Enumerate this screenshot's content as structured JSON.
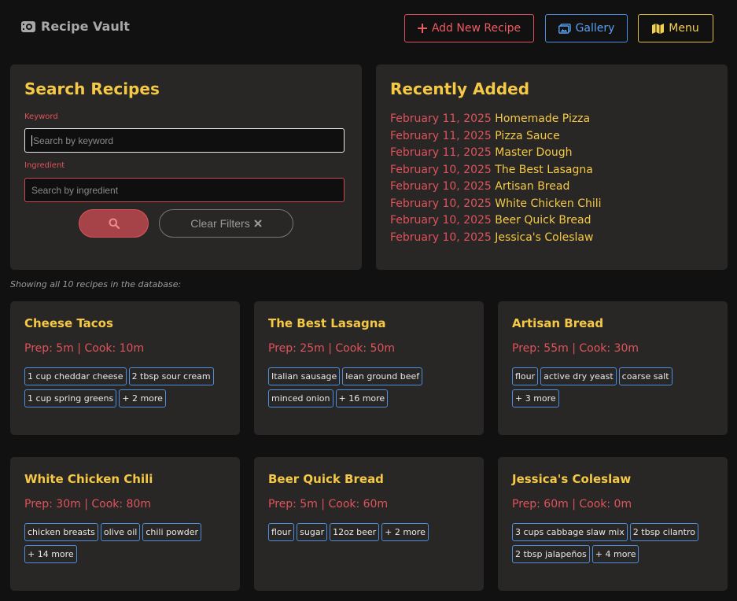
{
  "header": {
    "brand": "Recipe Vault",
    "add_label": "Add New Recipe",
    "gallery_label": "Gallery",
    "menu_label": "Menu"
  },
  "search": {
    "title": "Search Recipes",
    "keyword_label": "Keyword",
    "keyword_placeholder": "Search by keyword",
    "ingredient_label": "Ingredient",
    "ingredient_placeholder": "Search by ingredient",
    "clear_label": "Clear Filters"
  },
  "recent": {
    "title": "Recently Added",
    "items": [
      {
        "date": "February 11, 2025",
        "name": "Homemade Pizza"
      },
      {
        "date": "February 11, 2025",
        "name": "Pizza Sauce"
      },
      {
        "date": "February 11, 2025",
        "name": "Master Dough"
      },
      {
        "date": "February 10, 2025",
        "name": "The Best Lasagna"
      },
      {
        "date": "February 10, 2025",
        "name": "Artisan Bread"
      },
      {
        "date": "February 10, 2025",
        "name": "White Chicken Chili"
      },
      {
        "date": "February 10, 2025",
        "name": "Beer Quick Bread"
      },
      {
        "date": "February 10, 2025",
        "name": "Jessica's Coleslaw"
      }
    ]
  },
  "showing_text": "Showing all 10 recipes in the database:",
  "recipes": [
    {
      "title": "Cheese Tacos",
      "time": "Prep: 5m | Cook: 10m",
      "tags": [
        "1 cup cheddar cheese",
        "2 tbsp sour cream",
        "1 cup spring greens",
        "+ 2 more"
      ]
    },
    {
      "title": "The Best Lasagna",
      "time": "Prep: 25m | Cook: 50m",
      "tags": [
        "Italian sausage",
        "lean ground beef",
        "minced onion",
        "+ 16 more"
      ]
    },
    {
      "title": "Artisan Bread",
      "time": "Prep: 55m | Cook: 30m",
      "tags": [
        "flour",
        "active dry yeast",
        "coarse salt",
        "+ 3 more"
      ]
    },
    {
      "title": "White Chicken Chili",
      "time": "Prep: 30m | Cook: 80m",
      "tags": [
        "chicken breasts",
        "olive oil",
        "chili powder",
        "+ 14 more"
      ]
    },
    {
      "title": "Beer Quick Bread",
      "time": "Prep: 5m | Cook: 60m",
      "tags": [
        "flour",
        "sugar",
        "12oz beer",
        "+ 2 more"
      ]
    },
    {
      "title": "Jessica's Coleslaw",
      "time": "Prep: 60m | Cook: 0m",
      "tags": [
        "3 cups cabbage slaw mix",
        "2 tbsp cilantro",
        "2 tbsp jalapeños",
        "+ 4 more"
      ]
    }
  ],
  "colors": {
    "background": "#111111",
    "panel": "#282725",
    "accent_yellow": "#f5c946",
    "accent_red": "#e0525b",
    "accent_blue": "#4a8fe0"
  }
}
